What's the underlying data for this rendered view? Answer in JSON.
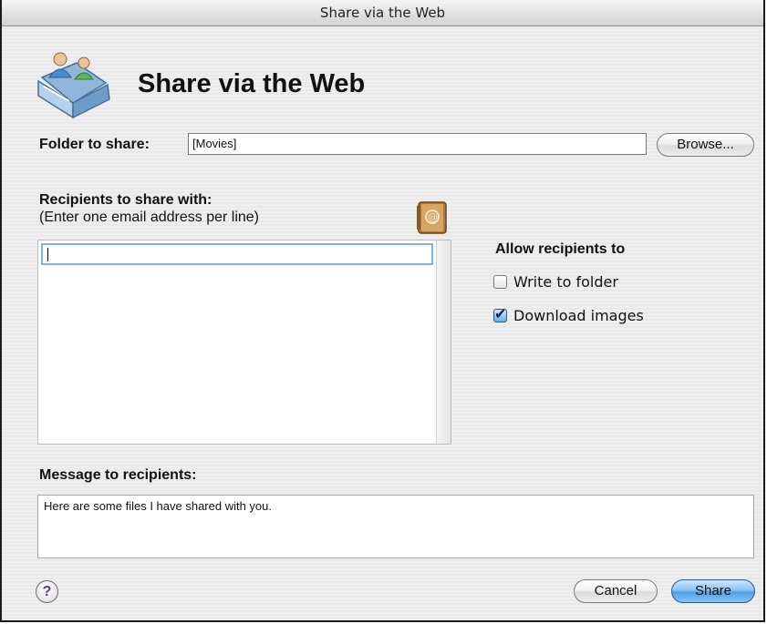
{
  "window": {
    "title": "Share via the Web"
  },
  "header": {
    "title": "Share via the Web",
    "icon": "shared-folder-people-icon"
  },
  "folder": {
    "label": "Folder to share:",
    "value": "[Movies]",
    "browse_label": "Browse..."
  },
  "recipients": {
    "label": "Recipients to share with:",
    "hint": "(Enter one email address per line)",
    "value": "",
    "address_book_icon": "address-book-icon"
  },
  "permissions": {
    "title": "Allow recipients to",
    "options": [
      {
        "label": "Write to folder",
        "checked": false
      },
      {
        "label": "Download images",
        "checked": true
      }
    ]
  },
  "message": {
    "label": "Message to recipients:",
    "value": "Here are some files I have shared with you."
  },
  "footer": {
    "help_label": "?",
    "cancel_label": "Cancel",
    "share_label": "Share"
  },
  "colors": {
    "accent": "#4f9ee6",
    "focus_ring": "#7db3ea"
  }
}
